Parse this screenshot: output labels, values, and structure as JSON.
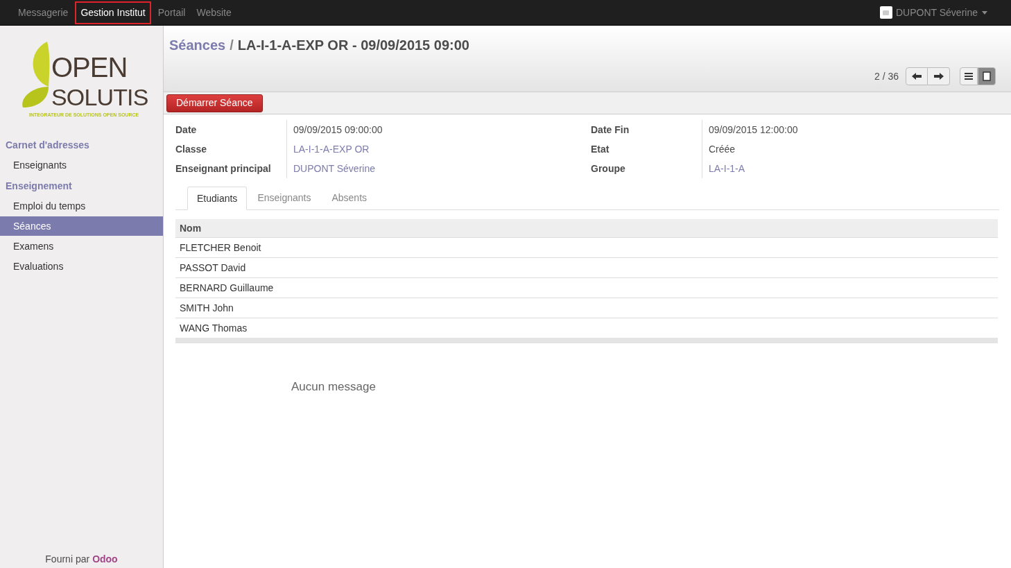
{
  "top_menu": [
    {
      "label": "Messagerie",
      "selected": false
    },
    {
      "label": "Gestion Institut",
      "selected": true
    },
    {
      "label": "Portail",
      "selected": false
    },
    {
      "label": "Website",
      "selected": false
    }
  ],
  "user": {
    "name": "DUPONT Séverine"
  },
  "logo": {
    "line1": "OPEN",
    "line2": "SOLUTIS",
    "tagline": "INTEGRATEUR DE SOLUTIONS OPEN SOURCE"
  },
  "sidebar": {
    "sections": [
      {
        "title": "Carnet d'adresses",
        "items": [
          {
            "label": "Enseignants",
            "selected": false
          }
        ]
      },
      {
        "title": "Enseignement",
        "items": [
          {
            "label": "Emploi du temps",
            "selected": false
          },
          {
            "label": "Séances",
            "selected": true
          },
          {
            "label": "Examens",
            "selected": false
          },
          {
            "label": "Evaluations",
            "selected": false
          }
        ]
      }
    ],
    "footer_prefix": "Fourni par",
    "footer_brand": "Odoo"
  },
  "breadcrumb": {
    "parent": "Séances",
    "separator": "/",
    "current": "LA-I-1-A-EXP OR - 09/09/2015 09:00"
  },
  "pager": {
    "text": "2 / 36"
  },
  "view_switch": [
    {
      "kind": "list",
      "selected": false
    },
    {
      "kind": "form",
      "selected": true
    }
  ],
  "action_button": "Démarrer Séance",
  "fields_left": [
    {
      "label": "Date",
      "value": "09/09/2015 09:00:00",
      "kind": "text"
    },
    {
      "label": "Classe",
      "value": "LA-I-1-A-EXP OR",
      "kind": "link"
    },
    {
      "label": "Enseignant principal",
      "value": "DUPONT Séverine",
      "kind": "link"
    }
  ],
  "fields_right": [
    {
      "label": "Date Fin",
      "value": "09/09/2015 12:00:00",
      "kind": "text"
    },
    {
      "label": "Etat",
      "value": "Créée",
      "kind": "text"
    },
    {
      "label": "Groupe",
      "value": "LA-I-1-A",
      "kind": "link"
    }
  ],
  "tabs": [
    {
      "label": "Etudiants",
      "selected": true
    },
    {
      "label": "Enseignants",
      "selected": false
    },
    {
      "label": "Absents",
      "selected": false
    }
  ],
  "table": {
    "columns": [
      "Nom"
    ],
    "rows": [
      [
        "FLETCHER Benoit"
      ],
      [
        "PASSOT David"
      ],
      [
        "BERNARD Guillaume"
      ],
      [
        "SMITH John"
      ],
      [
        "WANG Thomas"
      ]
    ]
  },
  "chatter": {
    "empty_text": "Aucun message"
  }
}
